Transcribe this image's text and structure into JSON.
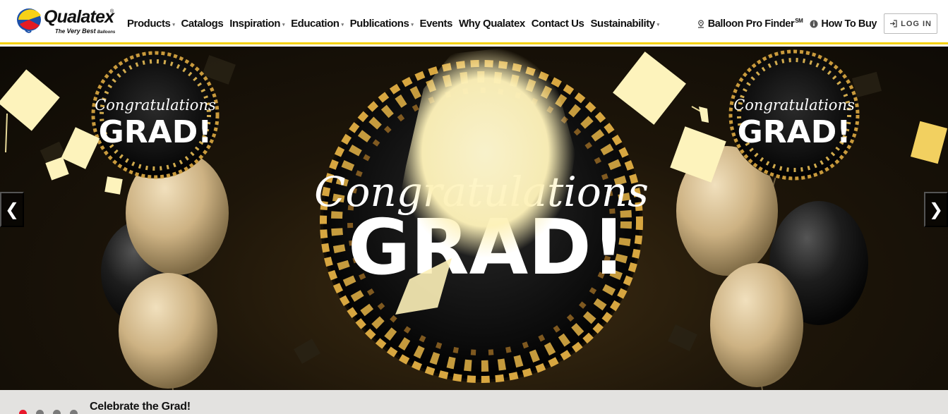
{
  "brand": {
    "name": "Qualatex",
    "trademark": "®",
    "tagline_prefix": "The",
    "tagline_emphasis": "Very Best",
    "tagline_suffix": "Balloons"
  },
  "nav": {
    "items": [
      {
        "label": "Products",
        "dropdown": true
      },
      {
        "label": "Catalogs",
        "dropdown": false
      },
      {
        "label": "Inspiration",
        "dropdown": true
      },
      {
        "label": "Education",
        "dropdown": true
      },
      {
        "label": "Publications",
        "dropdown": true
      },
      {
        "label": "Events",
        "dropdown": false
      },
      {
        "label": "Why Qualatex",
        "dropdown": false
      },
      {
        "label": "Contact Us",
        "dropdown": false
      },
      {
        "label": "Sustainability",
        "dropdown": true
      }
    ],
    "caret_glyph": "▾"
  },
  "utility": {
    "finder_label": "Balloon Pro Finder",
    "finder_mark": "SM",
    "finder_icon": "map-pin-icon",
    "how_to_buy_label": "How To Buy",
    "how_to_buy_icon": "info-icon",
    "login_label": "LOG IN",
    "login_icon": "login-icon"
  },
  "hero": {
    "balloon_text_line1": "Congratulations",
    "balloon_text_line2": "GRAD!",
    "prev_glyph": "❮",
    "next_glyph": "❯"
  },
  "slider": {
    "dot_count": 4,
    "active_dot": 1,
    "caption": "Celebrate the Grad!"
  },
  "colors": {
    "accent_yellow": "#f5d10a",
    "active_dot": "#e8192c",
    "inactive_dot": "#7a7a7a",
    "balloon_gold": "#d7bf92",
    "balloon_black": "#151515",
    "cap_cream": "#fdf4bf"
  }
}
